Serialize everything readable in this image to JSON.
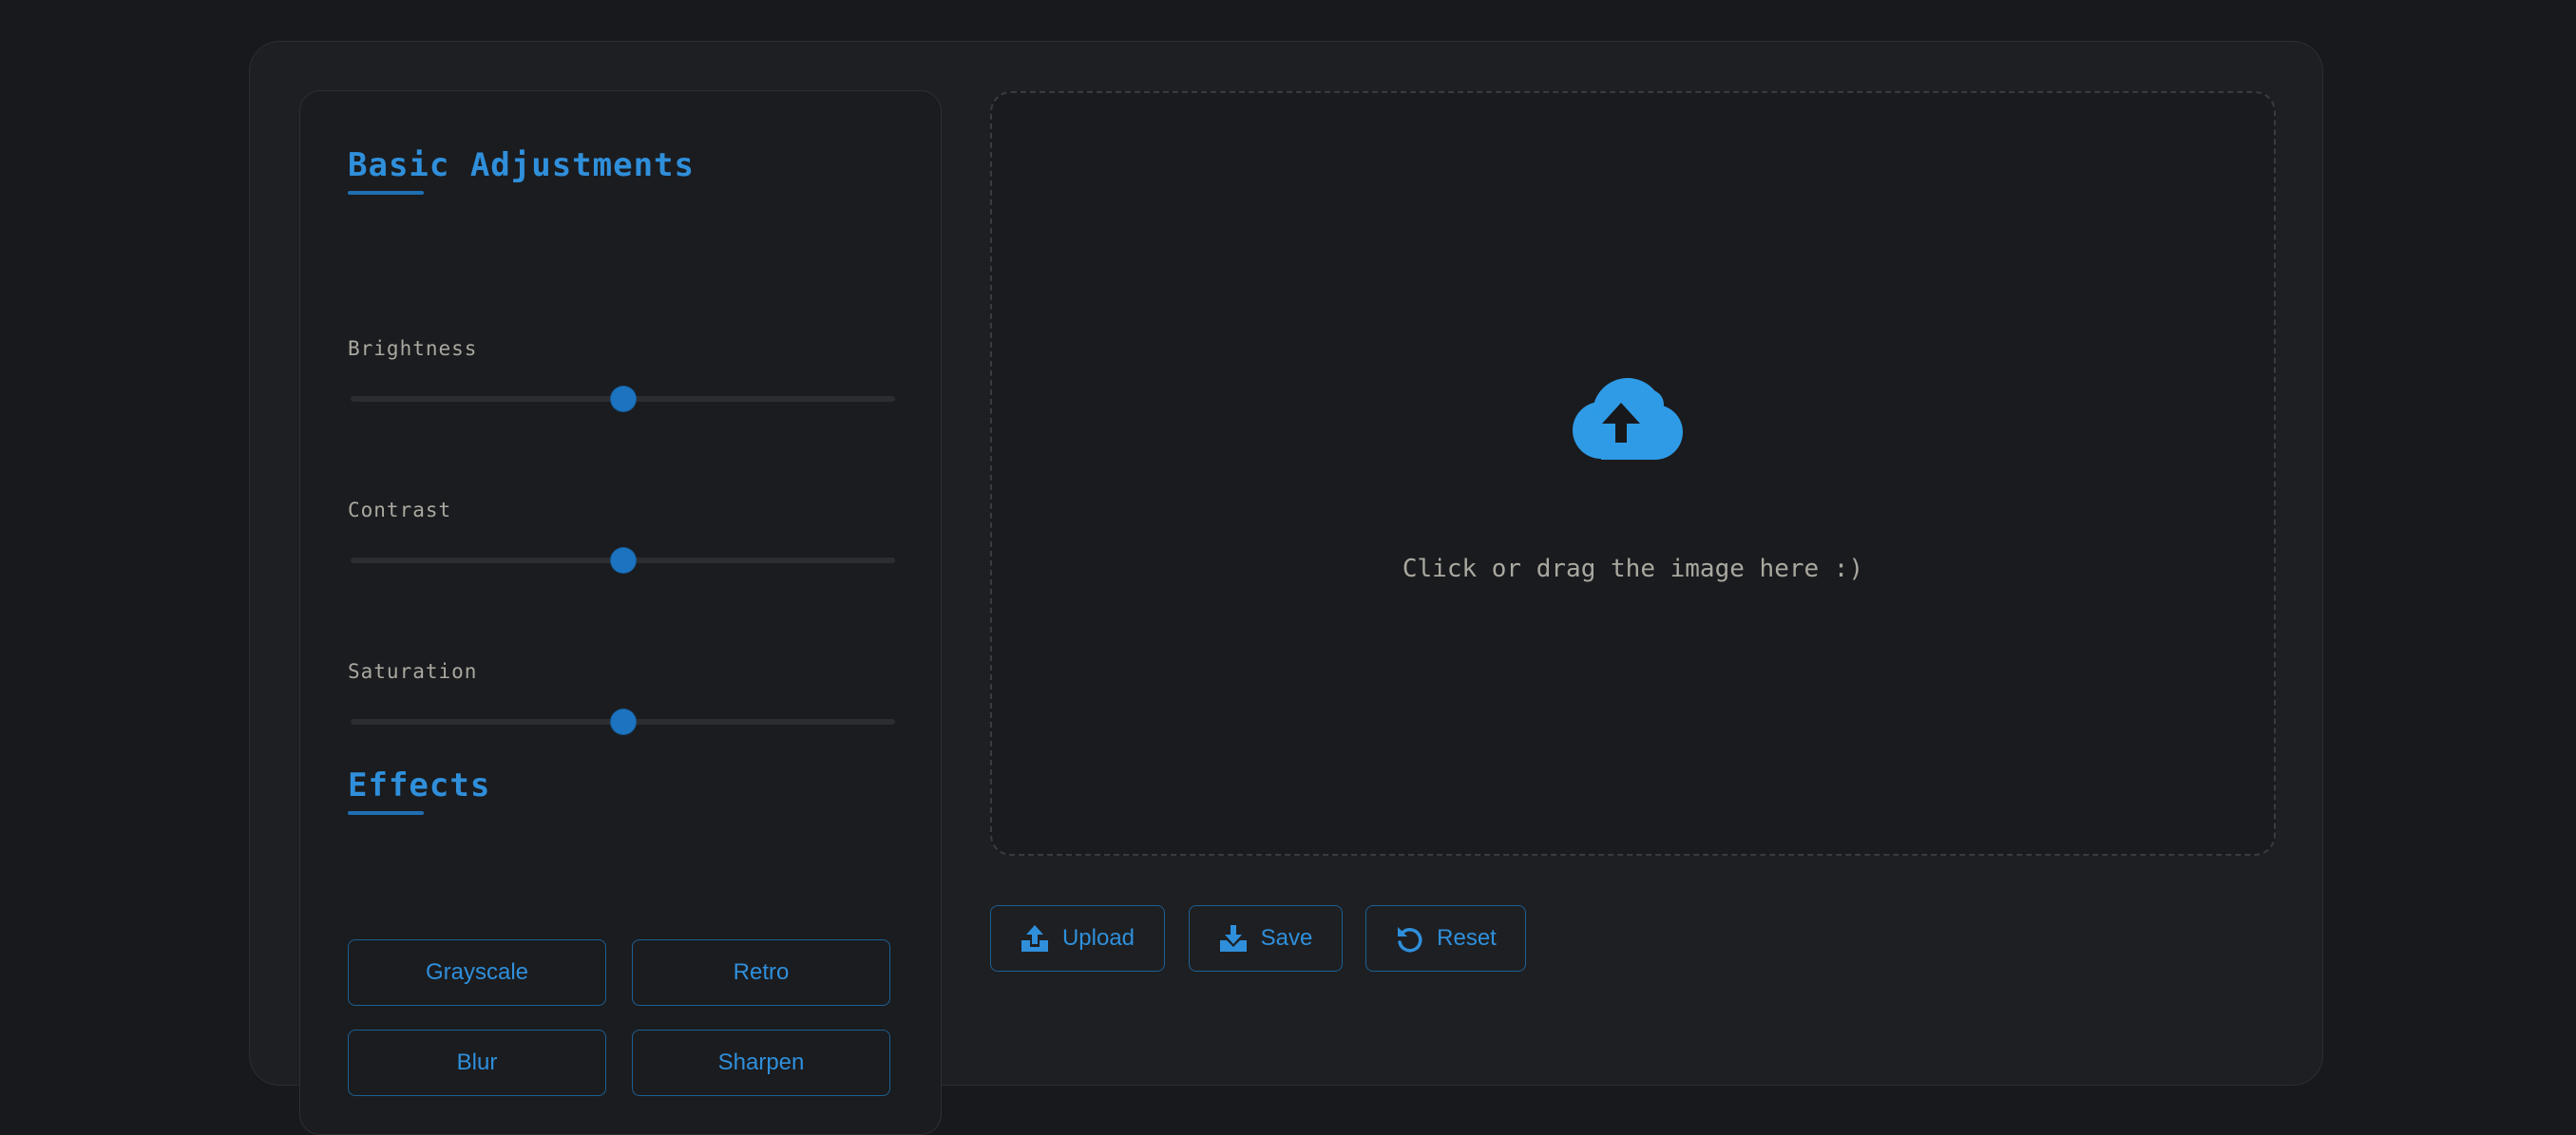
{
  "colors": {
    "background": "#18191c",
    "panel": "#1e1f22",
    "accent": "#2f8fdb",
    "slider_thumb": "#1c74c1",
    "muted_text": "#a9a8a0"
  },
  "sidebar": {
    "basic_title": "Basic Adjustments",
    "sliders": [
      {
        "label": "Brightness",
        "value": 0.5
      },
      {
        "label": "Contrast",
        "value": 0.5
      },
      {
        "label": "Saturation",
        "value": 0.5
      }
    ],
    "effects_title": "Effects",
    "effects": [
      "Grayscale",
      "Retro",
      "Blur",
      "Sharpen"
    ]
  },
  "dropzone": {
    "icon": "cloud-upload-icon",
    "text": "Click or drag the image here :)"
  },
  "actions": [
    {
      "label": "Upload",
      "icon": "upload-icon"
    },
    {
      "label": "Save",
      "icon": "download-icon"
    },
    {
      "label": "Reset",
      "icon": "reset-icon"
    }
  ]
}
